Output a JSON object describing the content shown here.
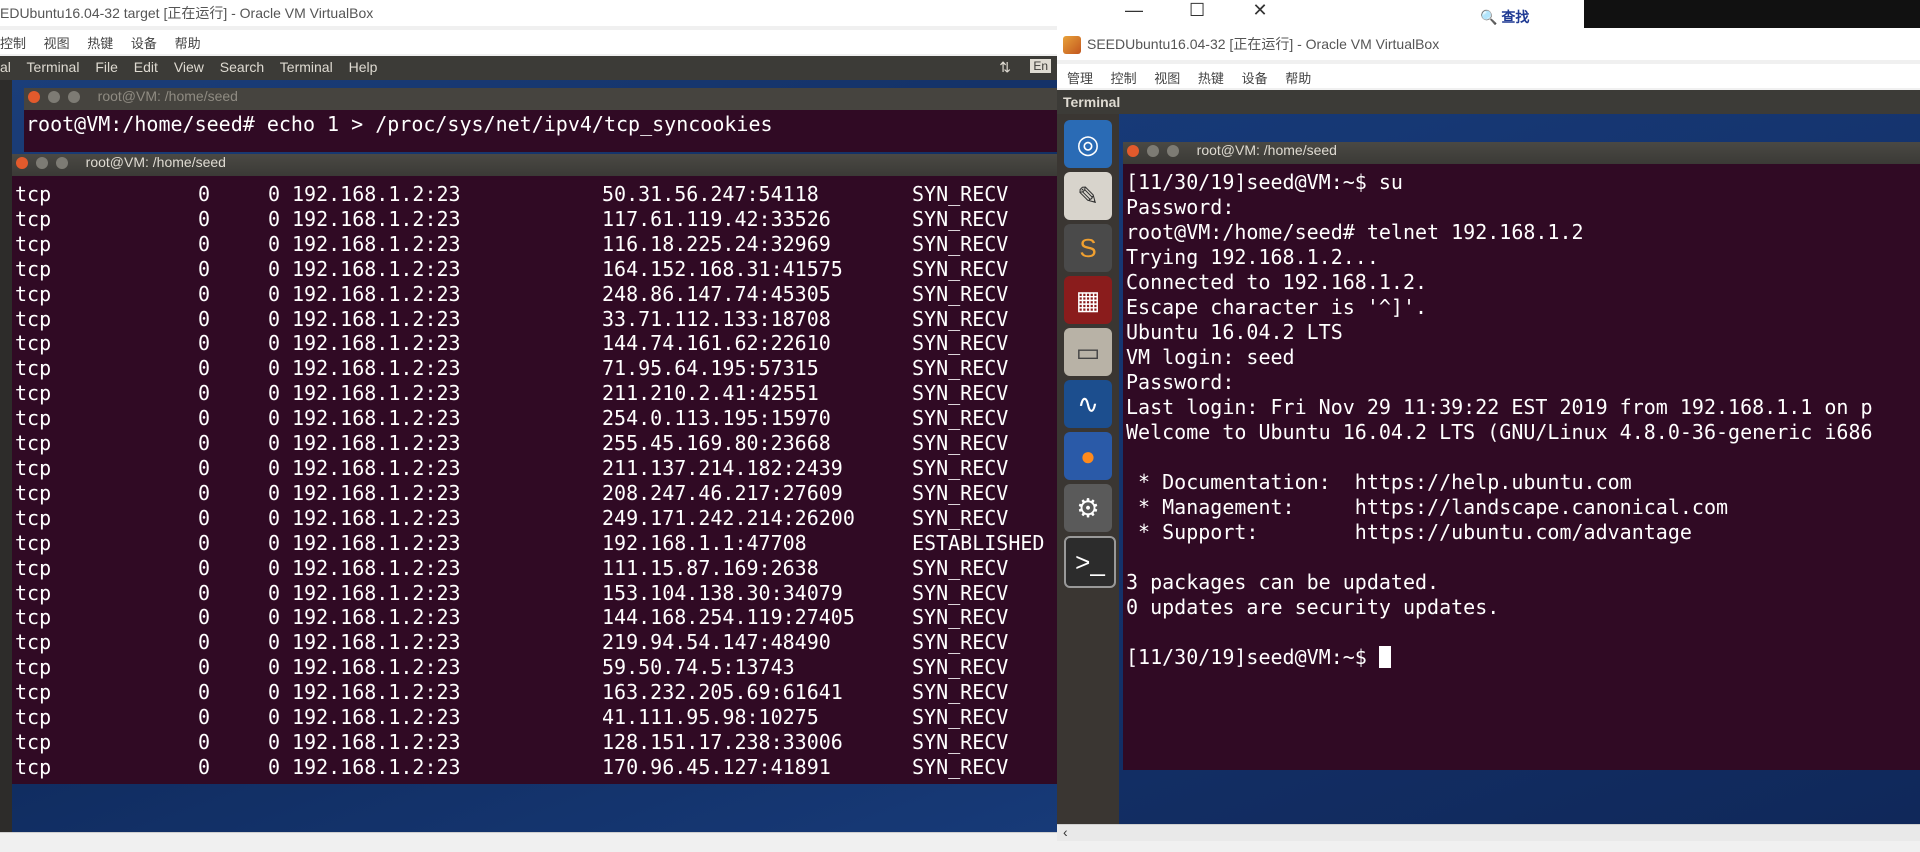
{
  "left_window": {
    "title": "EDUbuntu16.04-32 target [正在运行] - Oracle VM VirtualBox",
    "vbox_menu": [
      "控制",
      "视图",
      "热键",
      "设备",
      "帮助"
    ],
    "ubuntu_menu": [
      "al",
      "Terminal",
      "File",
      "Edit",
      "View",
      "Search",
      "Terminal",
      "Help"
    ],
    "panel_indicators": [
      "⇅",
      "En"
    ],
    "back_terminal": {
      "title": "root@VM: /home/seed",
      "command": "root@VM:/home/seed# echo 1 > /proc/sys/net/ipv4/tcp_syncookies"
    },
    "front_terminal": {
      "title": "root@VM: /home/seed",
      "rows": [
        {
          "proto": "tcp",
          "recvq": "0",
          "sendq": "0",
          "local": "192.168.1.2:23",
          "foreign": "50.31.56.247:54118",
          "state": "SYN_RECV"
        },
        {
          "proto": "tcp",
          "recvq": "0",
          "sendq": "0",
          "local": "192.168.1.2:23",
          "foreign": "117.61.119.42:33526",
          "state": "SYN_RECV"
        },
        {
          "proto": "tcp",
          "recvq": "0",
          "sendq": "0",
          "local": "192.168.1.2:23",
          "foreign": "116.18.225.24:32969",
          "state": "SYN_RECV"
        },
        {
          "proto": "tcp",
          "recvq": "0",
          "sendq": "0",
          "local": "192.168.1.2:23",
          "foreign": "164.152.168.31:41575",
          "state": "SYN_RECV"
        },
        {
          "proto": "tcp",
          "recvq": "0",
          "sendq": "0",
          "local": "192.168.1.2:23",
          "foreign": "248.86.147.74:45305",
          "state": "SYN_RECV"
        },
        {
          "proto": "tcp",
          "recvq": "0",
          "sendq": "0",
          "local": "192.168.1.2:23",
          "foreign": "33.71.112.133:18708",
          "state": "SYN_RECV"
        },
        {
          "proto": "tcp",
          "recvq": "0",
          "sendq": "0",
          "local": "192.168.1.2:23",
          "foreign": "144.74.161.62:22610",
          "state": "SYN_RECV"
        },
        {
          "proto": "tcp",
          "recvq": "0",
          "sendq": "0",
          "local": "192.168.1.2:23",
          "foreign": "71.95.64.195:57315",
          "state": "SYN_RECV"
        },
        {
          "proto": "tcp",
          "recvq": "0",
          "sendq": "0",
          "local": "192.168.1.2:23",
          "foreign": "211.210.2.41:42551",
          "state": "SYN_RECV"
        },
        {
          "proto": "tcp",
          "recvq": "0",
          "sendq": "0",
          "local": "192.168.1.2:23",
          "foreign": "254.0.113.195:15970",
          "state": "SYN_RECV"
        },
        {
          "proto": "tcp",
          "recvq": "0",
          "sendq": "0",
          "local": "192.168.1.2:23",
          "foreign": "255.45.169.80:23668",
          "state": "SYN_RECV"
        },
        {
          "proto": "tcp",
          "recvq": "0",
          "sendq": "0",
          "local": "192.168.1.2:23",
          "foreign": "211.137.214.182:2439",
          "state": "SYN_RECV"
        },
        {
          "proto": "tcp",
          "recvq": "0",
          "sendq": "0",
          "local": "192.168.1.2:23",
          "foreign": "208.247.46.217:27609",
          "state": "SYN_RECV"
        },
        {
          "proto": "tcp",
          "recvq": "0",
          "sendq": "0",
          "local": "192.168.1.2:23",
          "foreign": "249.171.242.214:26200",
          "state": "SYN_RECV"
        },
        {
          "proto": "tcp",
          "recvq": "0",
          "sendq": "0",
          "local": "192.168.1.2:23",
          "foreign": "192.168.1.1:47708",
          "state": "ESTABLISHED"
        },
        {
          "proto": "tcp",
          "recvq": "0",
          "sendq": "0",
          "local": "192.168.1.2:23",
          "foreign": "111.15.87.169:2638",
          "state": "SYN_RECV"
        },
        {
          "proto": "tcp",
          "recvq": "0",
          "sendq": "0",
          "local": "192.168.1.2:23",
          "foreign": "153.104.138.30:34079",
          "state": "SYN_RECV"
        },
        {
          "proto": "tcp",
          "recvq": "0",
          "sendq": "0",
          "local": "192.168.1.2:23",
          "foreign": "144.168.254.119:27405",
          "state": "SYN_RECV"
        },
        {
          "proto": "tcp",
          "recvq": "0",
          "sendq": "0",
          "local": "192.168.1.2:23",
          "foreign": "219.94.54.147:48490",
          "state": "SYN_RECV"
        },
        {
          "proto": "tcp",
          "recvq": "0",
          "sendq": "0",
          "local": "192.168.1.2:23",
          "foreign": "59.50.74.5:13743",
          "state": "SYN_RECV"
        },
        {
          "proto": "tcp",
          "recvq": "0",
          "sendq": "0",
          "local": "192.168.1.2:23",
          "foreign": "163.232.205.69:61641",
          "state": "SYN_RECV"
        },
        {
          "proto": "tcp",
          "recvq": "0",
          "sendq": "0",
          "local": "192.168.1.2:23",
          "foreign": "41.111.95.98:10275",
          "state": "SYN_RECV"
        },
        {
          "proto": "tcp",
          "recvq": "0",
          "sendq": "0",
          "local": "192.168.1.2:23",
          "foreign": "128.151.17.238:33006",
          "state": "SYN_RECV"
        },
        {
          "proto": "tcp",
          "recvq": "0",
          "sendq": "0",
          "local": "192.168.1.2:23",
          "foreign": "170.96.45.127:41891",
          "state": "SYN_RECV"
        }
      ]
    }
  },
  "host": {
    "window_buttons": [
      "—",
      "☐",
      "✕"
    ],
    "search_label": "查找"
  },
  "right_window": {
    "title": "SEEDUbuntu16.04-32 [正在运行] - Oracle VM VirtualBox",
    "vbox_menu": [
      "管理",
      "控制",
      "视图",
      "热键",
      "设备",
      "帮助"
    ],
    "panel_label": "Terminal",
    "terminal": {
      "title": "root@VM: /home/seed",
      "lines": [
        "[11/30/19]seed@VM:~$ su",
        "Password:",
        "root@VM:/home/seed# telnet 192.168.1.2",
        "Trying 192.168.1.2...",
        "Connected to 192.168.1.2.",
        "Escape character is '^]'.",
        "Ubuntu 16.04.2 LTS",
        "VM login: seed",
        "Password:",
        "Last login: Fri Nov 29 11:39:22 EST 2019 from 192.168.1.1 on p",
        "Welcome to Ubuntu 16.04.2 LTS (GNU/Linux 4.8.0-36-generic i686",
        "",
        " * Documentation:  https://help.ubuntu.com",
        " * Management:     https://landscape.canonical.com",
        " * Support:        https://ubuntu.com/advantage",
        "",
        "3 packages can be updated.",
        "0 updates are security updates.",
        "",
        "[11/30/19]seed@VM:~$ "
      ]
    },
    "launcher_icons": [
      "ubuntu-dash-icon",
      "text-editor-icon",
      "sublime-text-icon",
      "system-monitor-icon",
      "file-manager-icon",
      "wireshark-icon",
      "firefox-icon",
      "system-settings-icon",
      "terminal-icon"
    ]
  }
}
